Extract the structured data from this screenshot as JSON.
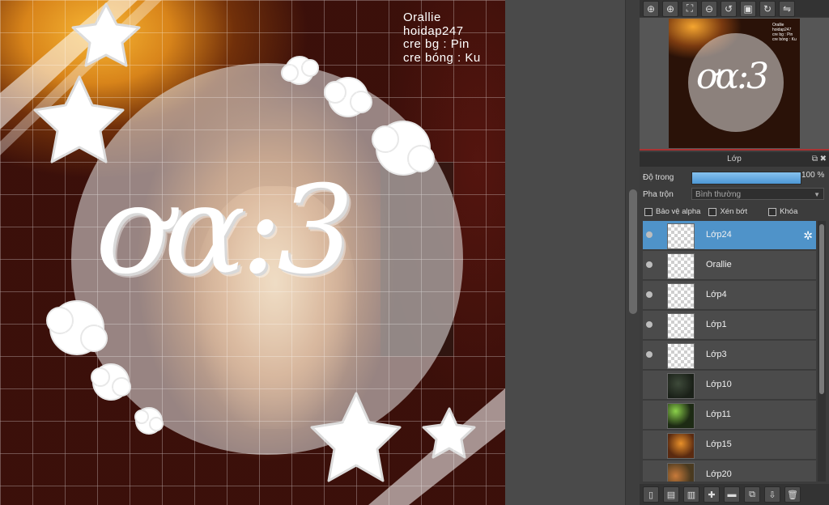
{
  "canvas": {
    "credits": [
      "Orallie",
      "hoidap247",
      "cre bg : Pin",
      "cre bóng : Ku"
    ],
    "main_text": "ơα:3"
  },
  "toolbar": {
    "icons": [
      "zoom-in-icon",
      "zoom-in-icon",
      "fit-icon",
      "zoom-out-icon",
      "rotate-left-icon",
      "reset-icon",
      "rotate-right-icon",
      "flip-icon"
    ]
  },
  "panel": {
    "title": "Lớp",
    "opacity_label": "Độ trong",
    "opacity_value": "100 %",
    "opacity_fraction": 1.0,
    "blend_label": "Pha trộn",
    "blend_value": "Bình thường",
    "checks": [
      "Bảo vệ alpha",
      "Xén bớt",
      "Khóa"
    ]
  },
  "layers": [
    {
      "name": "Lớp24",
      "visible": true,
      "active": true
    },
    {
      "name": "Orallie",
      "visible": true,
      "active": false
    },
    {
      "name": "Lớp4",
      "visible": true,
      "active": false
    },
    {
      "name": "Lớp1",
      "visible": true,
      "active": false
    },
    {
      "name": "Lớp3",
      "visible": true,
      "active": false
    },
    {
      "name": "Lớp10",
      "visible": false,
      "active": false
    },
    {
      "name": "Lớp11",
      "visible": false,
      "active": false
    },
    {
      "name": "Lớp15",
      "visible": false,
      "active": false
    },
    {
      "name": "Lớp20",
      "visible": false,
      "active": false
    }
  ],
  "colors": {
    "accent": "#4f93c9",
    "opacity_bar": "#6aaee5"
  }
}
